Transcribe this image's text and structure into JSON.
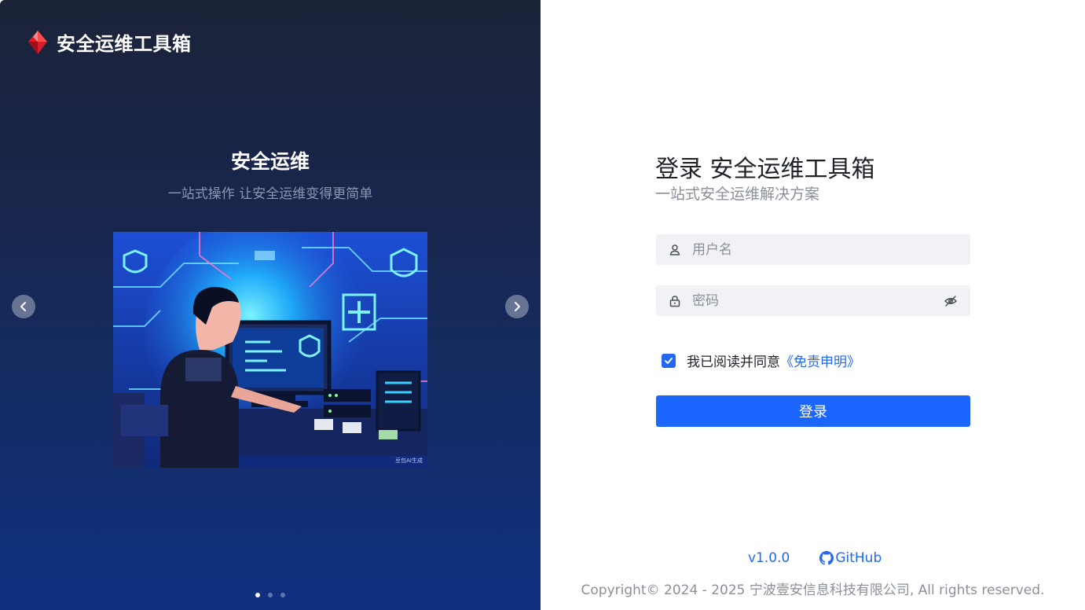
{
  "brand": {
    "name": "安全运维工具箱",
    "logo_icon": "red-diamond-logo-icon"
  },
  "carousel": {
    "title": "安全运维",
    "subtitle": "一站式操作 让安全运维变得更简单",
    "image_badge": "豆包AI生成",
    "slide_count": 3,
    "active_slide": 1
  },
  "login": {
    "title": "登录 安全运维工具箱",
    "subtitle": "一站式安全运维解决方案",
    "username_placeholder": "用户名",
    "password_placeholder": "密码",
    "agree_text": "我已阅读并同意",
    "agree_link": "《免责申明》",
    "agree_checked": true,
    "submit_label": "登录"
  },
  "footer": {
    "version": "v1.0.0",
    "github_label": "GitHub",
    "copyright": "Copyright© 2024 - 2025 宁波壹安信息科技有限公司, All rights reserved."
  },
  "colors": {
    "accent": "#1a66ff",
    "link": "#2468f2",
    "panel_dark": "#1b2338"
  }
}
